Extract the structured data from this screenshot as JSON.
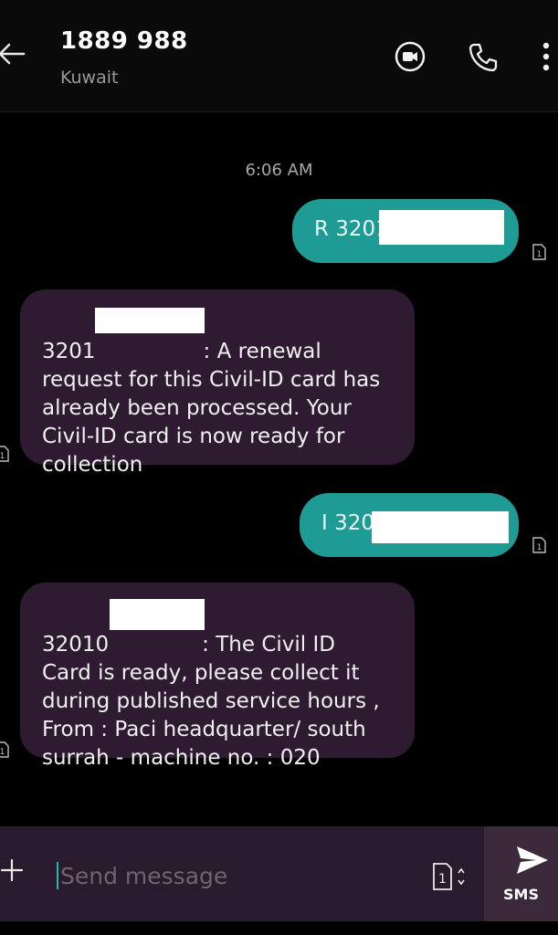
{
  "header": {
    "title": "1889 988",
    "subtitle": "Kuwait",
    "icons": [
      "back-arrow-icon",
      "video-call-icon",
      "phone-icon",
      "more-vertical-icon"
    ]
  },
  "conversation": {
    "timestamp": "6:06 AM",
    "messages": [
      {
        "direction": "outgoing",
        "text": "R 3201"
      },
      {
        "direction": "incoming",
        "text": "3201",
        "text_rest_line1": ": A renewal",
        "text_rest": "request for this Civil-ID card has\nalready been processed. Your\nCivil-ID card is now ready for\ncollection"
      },
      {
        "direction": "outgoing",
        "text": "I 320"
      },
      {
        "direction": "incoming",
        "text": "32010",
        "text_rest_line1": ": The Civil ID",
        "text_rest": "Card is ready, please collect it\nduring published service hours ,\nFrom : Paci headquarter/ south\nsurrah -   machine no. :  020"
      }
    ],
    "sim_indicator": "1"
  },
  "compose": {
    "placeholder": "Send message",
    "value": "",
    "sim_slot": "1",
    "send_label": "SMS"
  },
  "colors": {
    "outgoing_bubble": "#1e9b95",
    "incoming_bubble": "#2e1b31",
    "compose_bar": "#2a1a2d",
    "send_area": "#3a2a3c",
    "accent": "#2fb3ad"
  }
}
